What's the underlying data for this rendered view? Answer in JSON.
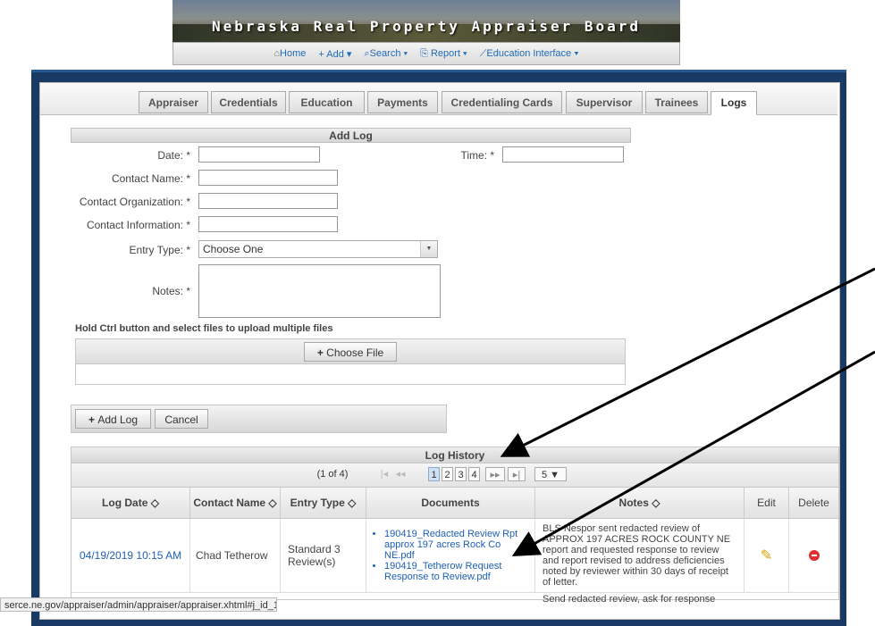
{
  "banner": {
    "title": "Nebraska Real Property Appraiser Board"
  },
  "menu": [
    {
      "icon": "home-icon",
      "label": "Home"
    },
    {
      "icon": "plus-icon",
      "label": "+ Add ▾"
    },
    {
      "icon": "search-icon",
      "label": "⌕Search ▾"
    },
    {
      "icon": "report-icon",
      "label": "⎘ Report ▾"
    },
    {
      "icon": "edit-icon",
      "label": "⟋Education Interface ▾"
    }
  ],
  "tabs": [
    "Appraiser",
    "Credentials",
    "Education",
    "Payments",
    "Credentialing Cards",
    "Supervisor",
    "Trainees",
    "Logs"
  ],
  "active_tab": "Logs",
  "add_log": {
    "header": "Add Log",
    "date_label": "Date: *",
    "time_label": "Time: *",
    "contact_name_label": "Contact Name: *",
    "contact_org_label": "Contact Organization: *",
    "contact_info_label": "Contact Information: *",
    "entry_type_label": "Entry Type: *",
    "entry_type_value": "Choose One",
    "notes_label": "Notes: *",
    "upload_hint": "Hold Ctrl button and select files to upload multiple files",
    "choose_file": "Choose File",
    "add_log_button": "Add Log",
    "cancel_button": "Cancel"
  },
  "log_history": {
    "header": "Log History",
    "page_info": "(1 of 4)",
    "pages": [
      "1",
      "2",
      "3",
      "4"
    ],
    "rows_per_page": "5 ▼",
    "columns": [
      "Log Date ◇",
      "Contact Name ◇",
      "Entry Type ◇",
      "Documents",
      "Notes ◇",
      "Edit",
      "Delete"
    ],
    "rows": [
      {
        "date": "04/19/2019 10:15 AM",
        "contact": "Chad Tetherow",
        "entry_type": "Standard 3 Review(s)",
        "documents": [
          "190419_Redacted Review Rpt approx 197 acres Rock Co NE.pdf",
          "190419_Tetherow Request Response to Review.pdf"
        ],
        "notes": "BLS Nespor sent redacted review of APPROX 197 ACRES ROCK COUNTY NE report and requested response to review and report revised to address deficiencies noted by reviewer within 30 days of receipt of letter."
      },
      {
        "notes": "Send redacted review, ask for response"
      }
    ]
  },
  "status_url": "serce.ne.gov/appraiser/admin/appraiser/appraiser.xhtml#j_id_1..."
}
